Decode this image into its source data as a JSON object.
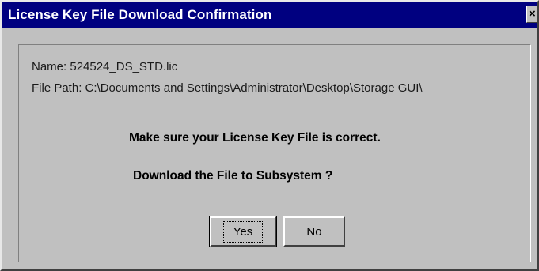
{
  "window": {
    "title": "License Key File Download Confirmation",
    "close_glyph": "×"
  },
  "file_info": {
    "name": "Name: 524524_DS_STD.lic",
    "path": "File Path: C:\\Documents and Settings\\Administrator\\Desktop\\Storage GUI\\"
  },
  "messages": {
    "line1": "Make sure your License Key File is correct.",
    "line2": "Download the File to Subsystem ?"
  },
  "buttons": {
    "yes_label": "Yes",
    "no_label": "No"
  },
  "colors": {
    "titlebar": "#000080",
    "face": "#c0c0c0"
  }
}
